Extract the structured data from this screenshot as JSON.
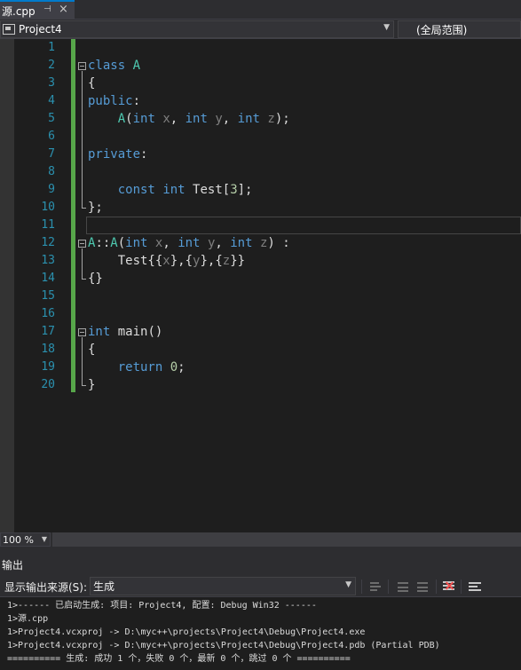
{
  "tab": {
    "title": "源.cpp",
    "pin_glyph": "⊣",
    "close_glyph": "×"
  },
  "nav": {
    "project": "Project4",
    "scope": "(全局范围)"
  },
  "editor": {
    "line_numbers": [
      "1",
      "2",
      "3",
      "4",
      "5",
      "6",
      "7",
      "8",
      "9",
      "10",
      "11",
      "12",
      "13",
      "14",
      "15",
      "16",
      "17",
      "18",
      "19",
      "20"
    ],
    "code_lines": [
      "",
      "class A",
      "{",
      "public:",
      "    A(int x, int y, int z);",
      "",
      "private:",
      "",
      "    const int Test[3];",
      "};",
      "",
      "A::A(int x, int y, int z) :",
      "    Test{{x},{y},{z}}",
      "{}",
      "",
      "",
      "int main()",
      "{",
      "    return 0;",
      "}"
    ],
    "current_line": 11
  },
  "zoom": {
    "label": "100 %"
  },
  "output": {
    "title": "输出",
    "source_label": "显示输出来源(S):",
    "source_value": "生成",
    "lines": [
      "1>------ 已启动生成: 项目: Project4, 配置: Debug Win32 ------",
      "1>源.cpp",
      "1>Project4.vcxproj -> D:\\myc++\\projects\\Project4\\Debug\\Project4.exe",
      "1>Project4.vcxproj -> D:\\myc++\\projects\\Project4\\Debug\\Project4.pdb (Partial PDB)",
      "========== 生成: 成功 1 个，失败 0 个，最新 0 个，跳过 0 个 =========="
    ]
  },
  "colors": {
    "background": "#1e1e1e",
    "keyword": "#569cd6",
    "type": "#4ec9b0",
    "parameter": "#7f7f7f",
    "number": "#b5cea8",
    "line_number": "#2b91af",
    "change_bar": "#57a64a",
    "accent": "#007acc"
  }
}
